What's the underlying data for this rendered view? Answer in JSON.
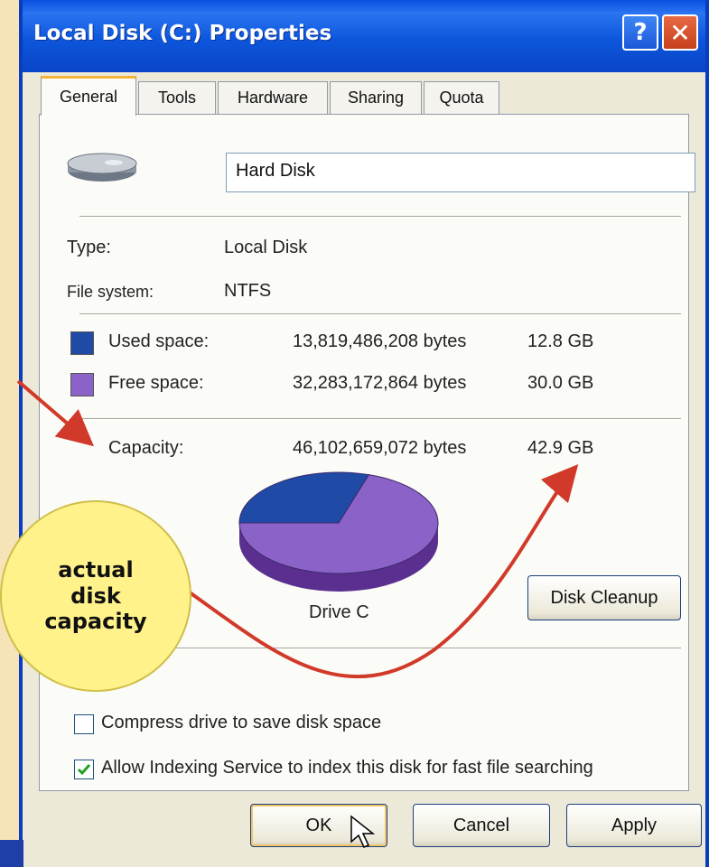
{
  "window": {
    "title": "Local Disk (C:) Properties",
    "help_label": "?",
    "close_label": "✕"
  },
  "tabs": [
    {
      "label": "General",
      "active": true
    },
    {
      "label": "Tools"
    },
    {
      "label": "Hardware"
    },
    {
      "label": "Sharing"
    },
    {
      "label": "Quota"
    }
  ],
  "general": {
    "drive_icon": "hard-drive-icon",
    "name_value": "Hard Disk",
    "type_label": "Type:",
    "type_value": "Local Disk",
    "fs_label": "File system:",
    "fs_value": "NTFS",
    "used_label": "Used space:",
    "used_bytes": "13,819,486,208 bytes",
    "used_gb": "12.8 GB",
    "free_label": "Free space:",
    "free_bytes": "32,283,172,864 bytes",
    "free_gb": "30.0 GB",
    "capacity_label": "Capacity:",
    "capacity_bytes": "46,102,659,072 bytes",
    "capacity_gb": "42.9 GB",
    "drive_label": "Drive C",
    "cleanup_label": "Disk Cleanup",
    "compress_label": "Compress drive to save disk space",
    "compress_checked": false,
    "index_label": "Allow Indexing Service to index this disk for fast file searching",
    "index_checked": true
  },
  "chart_data": {
    "type": "pie",
    "categories": [
      "Used space",
      "Free space"
    ],
    "values": [
      12.8,
      30.0
    ],
    "colors": [
      "#1f4aa6",
      "#8b62c7"
    ]
  },
  "buttons": {
    "ok": "OK",
    "cancel": "Cancel",
    "apply": "Apply"
  },
  "colors": {
    "used": "#1f4aa6",
    "free": "#8b62c7",
    "arrow": "#d13a2a",
    "callout": "#fff28a",
    "titlebar": "#0d56dc"
  },
  "annotation": {
    "callout_text": "actual\ndisk\ncapacity"
  }
}
